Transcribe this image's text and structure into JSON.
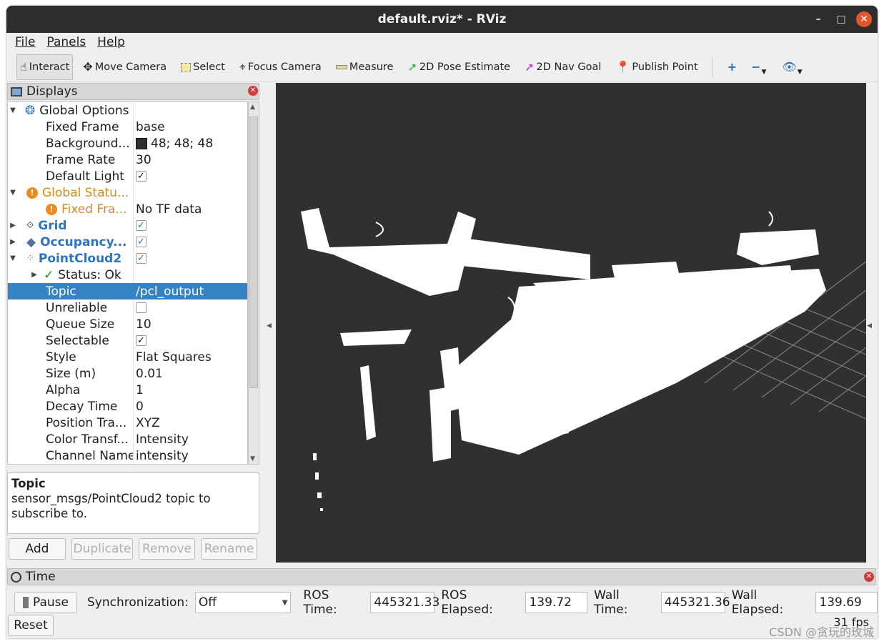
{
  "window": {
    "title": "default.rviz* - RViz"
  },
  "menu": [
    "File",
    "Panels",
    "Help"
  ],
  "toolbar": {
    "tools": [
      {
        "label": "Interact",
        "icon": "hand-icon"
      },
      {
        "label": "Move Camera",
        "icon": "move-camera-icon"
      },
      {
        "label": "Select",
        "icon": "select-icon"
      },
      {
        "label": "Focus Camera",
        "icon": "focus-camera-icon"
      },
      {
        "label": "Measure",
        "icon": "ruler-icon"
      },
      {
        "label": "2D Pose Estimate",
        "icon": "green-arrow-icon"
      },
      {
        "label": "2D Nav Goal",
        "icon": "magenta-arrow-icon"
      },
      {
        "label": "Publish Point",
        "icon": "map-pin-icon"
      }
    ]
  },
  "displays": {
    "title": "Displays",
    "rows": {
      "global_options": "Global Options",
      "fixed_frame_label": "Fixed Frame",
      "fixed_frame_value": "base",
      "background_label": "Background...",
      "background_value": "48; 48; 48",
      "frame_rate_label": "Frame Rate",
      "frame_rate_value": "30",
      "default_light_label": "Default Light",
      "global_status": "Global Statu...",
      "fixed_frame_status_label": "Fixed Fra...",
      "fixed_frame_status_value": "No TF data",
      "grid": "Grid",
      "occupancy": "Occupancy...",
      "pointcloud": "PointCloud2",
      "status_ok": "Status: Ok",
      "topic_label": "Topic",
      "topic_value": "/pcl_output",
      "unreliable_label": "Unreliable",
      "queue_size_label": "Queue Size",
      "queue_size_value": "10",
      "selectable_label": "Selectable",
      "style_label": "Style",
      "style_value": "Flat Squares",
      "size_label": "Size (m)",
      "size_value": "0.01",
      "alpha_label": "Alpha",
      "alpha_value": "1",
      "decay_label": "Decay Time",
      "decay_value": "0",
      "position_label": "Position Tra...",
      "position_value": "XYZ",
      "color_label": "Color Transf...",
      "color_value": "Intensity",
      "channel_label": "Channel Name",
      "channel_value": "intensity"
    },
    "description": {
      "title": "Topic",
      "text": "sensor_msgs/PointCloud2 topic to subscribe to."
    },
    "buttons": {
      "add": "Add",
      "duplicate": "Duplicate",
      "remove": "Remove",
      "rename": "Rename"
    }
  },
  "time": {
    "title": "Time",
    "pause": "Pause",
    "sync_label": "Synchronization:",
    "sync_value": "Off",
    "ros_time_label": "ROS Time:",
    "ros_time_value": "445321.33",
    "ros_elapsed_label": "ROS Elapsed:",
    "ros_elapsed_value": "139.72",
    "wall_time_label": "Wall Time:",
    "wall_time_value": "445321.36",
    "wall_elapsed_label": "Wall Elapsed:",
    "wall_elapsed_value": "139.69",
    "reset": "Reset",
    "fps": "31 fps"
  },
  "watermark": "CSDN @贪玩的玫城",
  "colors": {
    "viewport_bg": "#303030",
    "selection": "#3583c5"
  }
}
